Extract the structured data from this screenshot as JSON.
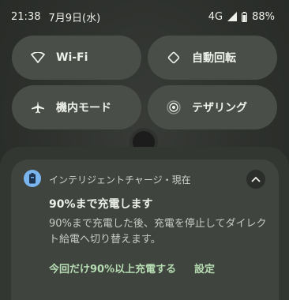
{
  "status_bar": {
    "time": "21:38",
    "date": "7月9日(水)",
    "network": "4G",
    "battery": "88%"
  },
  "tiles": {
    "wifi": "Wi-Fi",
    "rotate": "自動回転",
    "airplane": "機内モード",
    "tethering": "テザリング"
  },
  "notification": {
    "app_header": "インテリジェントチャージ・現在",
    "title": "90%まで充電します",
    "body": "90%まで充電した後、充電を停止してダイレクト給電へ切り替えます。",
    "action_1": "今回だけ90%以上充電する",
    "action_2": "設定"
  },
  "colors": {
    "accent_action": "#b6dcb2",
    "app_icon": "#7ab5f0",
    "tile": "#4a4e49"
  }
}
